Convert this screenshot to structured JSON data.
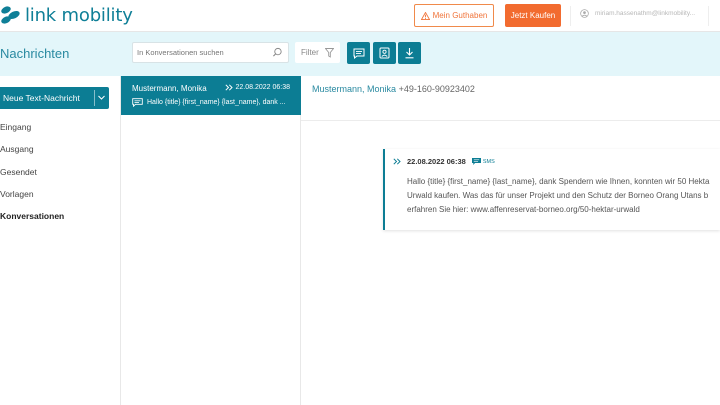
{
  "brand": {
    "name": "link mobility",
    "accent": "#0c7d94",
    "orange": "#f26b2f"
  },
  "header": {
    "guthaben_label": "Mein Guthaben",
    "kaufen_label": "Jetzt Kaufen",
    "user_email": "miriam.hassenathm@linkmobility..."
  },
  "band": {
    "title": "Nachrichten",
    "search_placeholder": "In Konversationen suchen",
    "filter_label": "Filter"
  },
  "sidebar": {
    "new_message_label": "Neue Text-Nachricht",
    "items": [
      {
        "label": "Eingang"
      },
      {
        "label": "Ausgang"
      },
      {
        "label": "Gesendet"
      },
      {
        "label": "Vorlagen"
      },
      {
        "label": "Konversationen"
      }
    ]
  },
  "conversations": [
    {
      "name": "Mustermann, Monika",
      "date": "22.08.2022 06:38",
      "preview": "Hallo {title} {first_name} {last_name}, dank ..."
    }
  ],
  "main": {
    "contact_name": "Mustermann, Monika",
    "contact_phone": "+49-160-90923402",
    "message": {
      "date": "22.08.2022 06:38",
      "type": "SMS",
      "lines": [
        "Hallo {title} {first_name} {last_name}, dank Spendern wie Ihnen, konnten wir 50 Hekta",
        "Urwald kaufen. Was das für unser Projekt und den Schutz der Borneo Orang Utans b",
        "erfahren Sie hier: www.affenreservat-borneo.org/50-hektar-urwald"
      ]
    }
  }
}
